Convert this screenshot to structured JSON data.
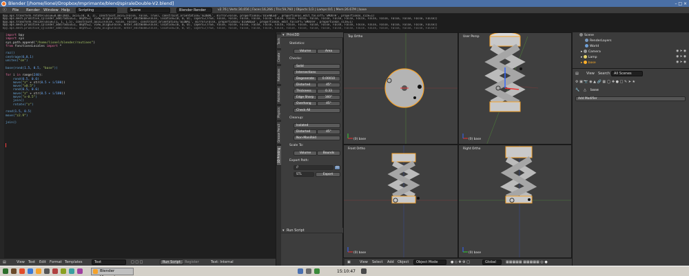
{
  "window": {
    "title": "Blender [/home/lionel/Dropbox/Imprimante/blend/spiraleDouble-V2.blend]"
  },
  "infobar": {
    "menus": [
      "File",
      "Render",
      "Window",
      "Help"
    ],
    "layout": "Scripting",
    "scene": "Scene",
    "engine": "Blender Render",
    "stats": "v2.76 | Verts:30,656 | Faces:16,266 | Tris:59,760 | Objects:1/3 | Lamps:0/1 | Mem:26.67M | base"
  },
  "console": [
    "bpy.ops.transform.rotate(value=0.0872665, axis=(0, 0, 1), constraint_axis=(False, False, True), constraint_orientation='GLOBAL', mirror=False, proportional='DISABLED', proportional_edit_falloff='SMOOTH', proportional_size=1)",
    "bpy.ops.mesh.primitive_cylinder_add(radius=1, depth=2, view_align=False, enter_editmode=False, location=(0, 0, 0), layers=(True, False, False, False, False, False, False, False, False, False, False, False, False, False, False, False, False, False, False, False))",
    "bpy.ops.transform.resize(value=(1, 1, 1.5), constraint_axis=(False, False, False), constraint_orientation='GLOBAL', mirror=False, proportional='DISABLED', proportional_edit_falloff='SMOOTH', proportional_size=1)",
    "bpy.ops.mesh.primitive_cylinder_add(radius=1, depth=2, view_align=False, enter_editmode=False, location=(0, 0, 0), layers=(True, False, False, False, False, False, False, False, False, False, False, False, False, False, False, False, False, False, False, False))"
  ],
  "code": [
    [
      {
        "t": "import",
        "c": "kw"
      },
      {
        "t": " bpy",
        "c": "plain"
      }
    ],
    [
      {
        "t": "import",
        "c": "kw"
      },
      {
        "t": " sys",
        "c": "plain"
      }
    ],
    [
      {
        "t": "sys.path.append(",
        "c": "plain"
      },
      {
        "t": "\"/home/lionel/blender/routines\"",
        "c": "str"
      },
      {
        "t": ")",
        "c": "plain"
      }
    ],
    [
      {
        "t": "from",
        "c": "kw"
      },
      {
        "t": " fonctionsLocales ",
        "c": "plain"
      },
      {
        "t": "import",
        "c": "kw"
      },
      {
        "t": " *",
        "c": "plain"
      }
    ],
    [],
    [
      {
        "t": "raz()",
        "c": "fn"
      }
    ],
    [
      {
        "t": "centrage(",
        "c": "fn"
      },
      {
        "t": "0,0,1",
        "c": "num"
      },
      {
        "t": ")",
        "c": "fn"
      }
    ],
    [
      {
        "t": "unites(",
        "c": "fn"
      },
      {
        "t": "\"cm\"",
        "c": "str"
      },
      {
        "t": ")",
        "c": "fn"
      }
    ],
    [],
    [
      {
        "t": "base(",
        "c": "fn"
      },
      {
        "t": "rond(",
        "c": "fn"
      },
      {
        "t": "1.5, 0.5, ",
        "c": "num"
      },
      {
        "t": "\"base\"",
        "c": "str"
      },
      {
        "t": "))",
        "c": "fn"
      }
    ],
    [],
    [
      {
        "t": "for",
        "c": "kw"
      },
      {
        "t": " i ",
        "c": "plain"
      },
      {
        "t": "in",
        "c": "kw"
      },
      {
        "t": " range(",
        "c": "plain"
      },
      {
        "t": "240",
        "c": "num"
      },
      {
        "t": "):",
        "c": "plain"
      }
    ],
    [
      {
        "t": "    rond(",
        "c": "fn"
      },
      {
        "t": "0.5, 0.6",
        "c": "num"
      },
      {
        "t": ")",
        "c": "fn"
      }
    ],
    [
      {
        "t": "    move(",
        "c": "fn"
      },
      {
        "t": "\"z\"",
        "c": "str"
      },
      {
        "t": " + str(",
        "c": "plain"
      },
      {
        "t": "0.5 + i/100",
        "c": "num"
      },
      {
        "t": "))",
        "c": "plain"
      }
    ],
    [
      {
        "t": "    move(",
        "c": "fn"
      },
      {
        "t": "\"x0.5\"",
        "c": "str"
      },
      {
        "t": ")",
        "c": "fn"
      }
    ],
    [
      {
        "t": "    rond(",
        "c": "fn"
      },
      {
        "t": "0.5, 0.6",
        "c": "num"
      },
      {
        "t": ")",
        "c": "fn"
      }
    ],
    [
      {
        "t": "    move(",
        "c": "fn"
      },
      {
        "t": "\"z\"",
        "c": "str"
      },
      {
        "t": " + str(",
        "c": "plain"
      },
      {
        "t": "0.5 + i/100",
        "c": "num"
      },
      {
        "t": "))",
        "c": "plain"
      }
    ],
    [
      {
        "t": "    move(",
        "c": "fn"
      },
      {
        "t": "\"x-0.5\"",
        "c": "str"
      },
      {
        "t": ")",
        "c": "fn"
      }
    ],
    [
      {
        "t": "    join()",
        "c": "fn"
      }
    ],
    [
      {
        "t": "    rotate(",
        "c": "fn"
      },
      {
        "t": "\"z\"",
        "c": "str"
      },
      {
        "t": ")",
        "c": "fn"
      }
    ],
    [],
    [
      {
        "t": "rond(",
        "c": "fn"
      },
      {
        "t": "1.5, 0.5",
        "c": "num"
      },
      {
        "t": ")",
        "c": "fn"
      }
    ],
    [
      {
        "t": "move(",
        "c": "fn"
      },
      {
        "t": "\"z2.9\"",
        "c": "str"
      },
      {
        "t": ")",
        "c": "fn"
      }
    ],
    [],
    [
      {
        "t": "join()",
        "c": "fn"
      }
    ]
  ],
  "editor_footer": {
    "menus": [
      "View",
      "Text",
      "Edit",
      "Format",
      "Templates"
    ],
    "text_name": "Text",
    "run_label": "Run Script",
    "register_label": "Register",
    "internal_label": "Text: Internal"
  },
  "tabs": [
    "Tools",
    "Create",
    "Relations",
    "Animation",
    "Physics",
    "Grease Pencil",
    "3D Printing"
  ],
  "toolshelf": {
    "panel_title": "Print3D",
    "statistics": {
      "title": "Statistics:",
      "volume": "Volume",
      "area": "Area"
    },
    "checks": {
      "title": "Checks:",
      "solid": "Solid",
      "intersections": "Intersections",
      "rows": [
        {
          "label": "Degenerate",
          "value": "0.00010"
        },
        {
          "label": "Distorted",
          "value": "45°"
        },
        {
          "label": "Thickness",
          "value": "0.33"
        },
        {
          "label": "Edge Sharp",
          "value": "160°"
        },
        {
          "label": "Overhang",
          "value": "45°"
        }
      ],
      "check_all": "Check All"
    },
    "cleanup": {
      "title": "Cleanup:",
      "isolated": "Isolated",
      "distorted": "Distorted",
      "distorted_value": "45°",
      "non_manifold": "Non-Manifold"
    },
    "scale": {
      "title": "Scale To:",
      "volume": "Volume",
      "bounds": "Bounds"
    },
    "export": {
      "title": "Export Path:",
      "path": "//",
      "format": "STL",
      "button": "Export"
    },
    "run_script": "Run Script"
  },
  "viewports": {
    "top": {
      "label": "Top Ortho",
      "object": "(0) base"
    },
    "persp": {
      "label": "User Persp",
      "object": "(0) base"
    },
    "front": {
      "label": "Front Ortho",
      "object": "(0) base"
    },
    "right": {
      "label": "Right Ortho",
      "object": "(0) base"
    }
  },
  "vp_footer": {
    "menus": [
      "View",
      "Select",
      "Add",
      "Object"
    ],
    "mode": "Object Mode",
    "orientation": "Global"
  },
  "outliner": {
    "root": "Scene",
    "items": [
      "RenderLayers",
      "World",
      "Camera",
      "Lamp",
      "base"
    ]
  },
  "props": {
    "view": "View",
    "search": "Search",
    "scenes": "All Scenes",
    "object_name": "base",
    "add_modifier": "Add Modifier"
  },
  "taskbar": {
    "task": "Blender [/home/...",
    "time": "15:10:47"
  },
  "colors": {
    "accent": "#4a6fa5",
    "selected": "#ffaf29",
    "object_fill": "#c8c8c8"
  }
}
